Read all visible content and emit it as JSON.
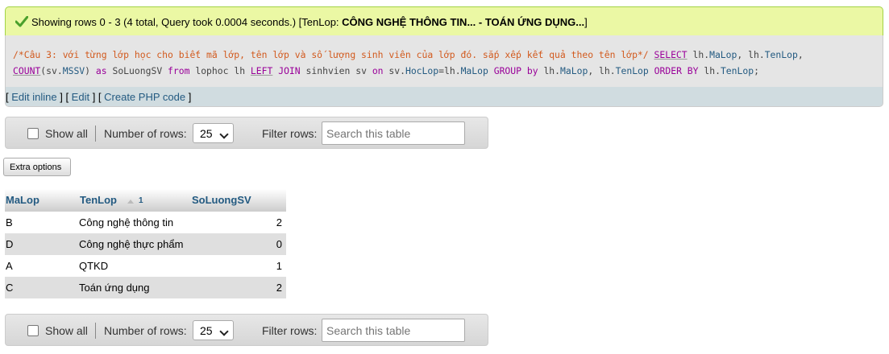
{
  "success": {
    "prefix": "Showing rows 0 - 3 (4 total, Query took 0.0004 seconds.) [TenLop: ",
    "range": "CÔNG NGHỆ THÔNG TIN... - TOÁN ỨNG DỤNG...",
    "suffix": "]"
  },
  "sql": {
    "comment": "/*Câu 3: với từng lớp học cho biết mã lớp, tên lớp và số lượng sinh viên của lớp đó. sắp xếp kết quả theo tên lớp*/",
    "select_kw": "SELECT",
    "p1": " lh.",
    "malop1": "MaLop",
    "p2": ", lh.",
    "tenlop1": "TenLop",
    "p3": ", ",
    "count_fn": "COUNT",
    "p4": "(sv.",
    "mssv": "MSSV",
    "p5": ") ",
    "as_kw": "as",
    "p6": " SoLuongSV ",
    "from_kw": "from",
    "p7": " lophoc lh ",
    "left_kw": "LEFT",
    "join_kw": "JOIN",
    "p8": " sinhvien sv ",
    "on_kw": "on",
    "p9": " sv.",
    "hoclop": "HocLop",
    "p10": "=lh.",
    "malop2": "MaLop",
    "group_kw": "GROUP",
    "by_kw": "by",
    "p11": " lh.",
    "malop3": "MaLop",
    "p12": ", lh.",
    "tenlop2": "TenLop",
    "order_kw": "ORDER",
    "by_kw2": "BY",
    "p13": " lh.",
    "tenlop3": "TenLop",
    "p14": ";"
  },
  "links": {
    "open1": "[ ",
    "edit_inline": "Edit inline",
    "mid1": " ] [ ",
    "edit": "Edit",
    "mid2": " ] [ ",
    "create_php": "Create PHP code",
    "close": " ]"
  },
  "navbar": {
    "show_all": "Show all",
    "number_of_rows": "Number of rows:",
    "rows_value": "25",
    "filter_rows": "Filter rows:",
    "search_placeholder": "Search this table"
  },
  "extra_options": "Extra options",
  "table": {
    "headers": [
      "MaLop",
      "TenLop",
      "SoLuongSV"
    ],
    "sort_index": "1",
    "rows": [
      [
        "B",
        "Công nghệ thông tin",
        "2"
      ],
      [
        "D",
        "Công nghệ thực phẩm",
        "0"
      ],
      [
        "A",
        "QTKD",
        "1"
      ],
      [
        "C",
        "Toán ứng dụng",
        "2"
      ]
    ]
  },
  "colors": {
    "success_bg": "#ebf8a4",
    "link": "#235a81",
    "comment": "#d25a1e",
    "keyword": "#990099"
  },
  "icons": {
    "success": "checkmark-icon",
    "sort": "sort-ascending-icon",
    "dropdown": "chevron-down-icon"
  }
}
